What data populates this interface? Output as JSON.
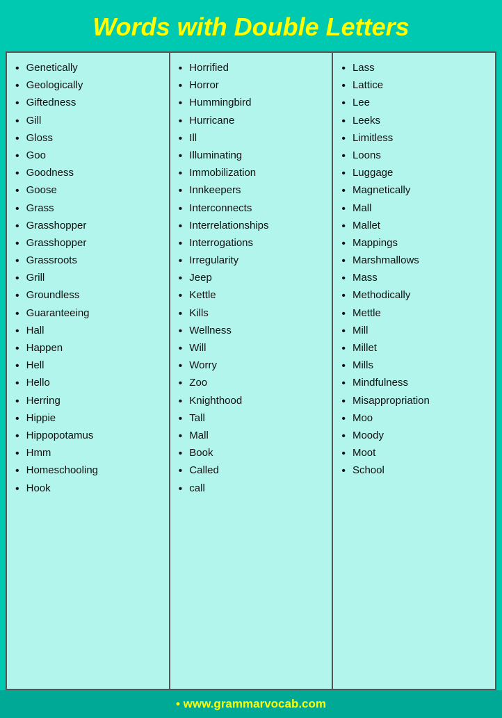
{
  "header": {
    "title": "Words with Double Letters"
  },
  "columns": [
    {
      "words": [
        "Genetically",
        "Geologically",
        "Giftedness",
        "Gill",
        "Gloss",
        "Goo",
        "Goodness",
        "Goose",
        "Grass",
        "Grasshopper",
        "Grasshopper",
        "Grassroots",
        "Grill",
        "Groundless",
        "Guaranteeing",
        "Hall",
        "Happen",
        "Hell",
        "Hello",
        "Herring",
        "Hippie",
        "Hippopotamus",
        "Hmm",
        "Homeschooling",
        "Hook"
      ]
    },
    {
      "words": [
        "Horrified",
        "Horror",
        "Hummingbird",
        "Hurricane",
        "Ill",
        "Illuminating",
        "Immobilization",
        "Innkeepers",
        "Interconnects",
        "Interrelationships",
        "Interrogations",
        "Irregularity",
        "Jeep",
        "Kettle",
        "Kills",
        "Wellness",
        "Will",
        "Worry",
        "Zoo",
        "Knighthood",
        "Tall",
        "Mall",
        "Book",
        "Called",
        "call"
      ]
    },
    {
      "words": [
        "Lass",
        "Lattice",
        "Lee",
        "Leeks",
        "Limitless",
        "Loons",
        "Luggage",
        "Magnetically",
        "Mall",
        "Mallet",
        "Mappings",
        "Marshmallows",
        "Mass",
        "Methodically",
        "Mettle",
        "Mill",
        "Millet",
        "Mills",
        "Mindfulness",
        "Misappropriation",
        "Moo",
        "Moody",
        "Moot",
        "School"
      ]
    }
  ],
  "footer": {
    "url": "www.grammarvocab.com"
  }
}
